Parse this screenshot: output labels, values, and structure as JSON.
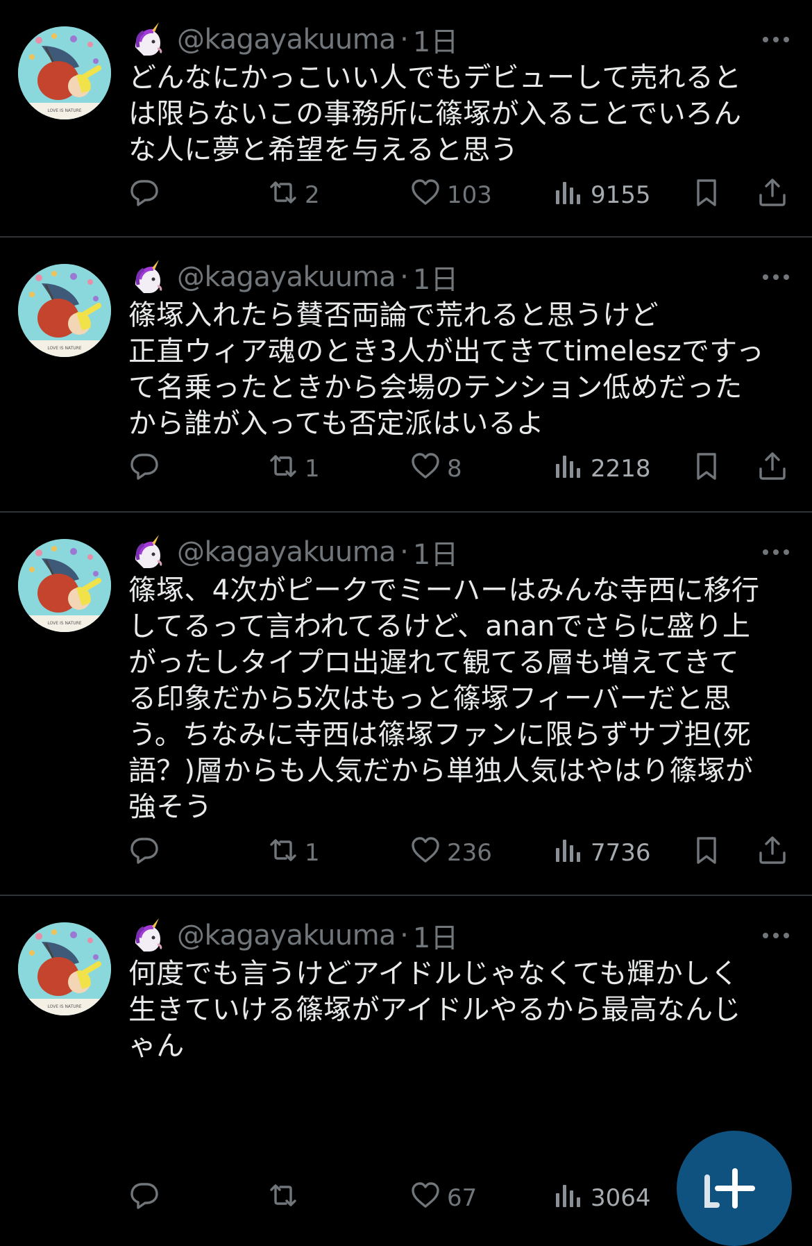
{
  "posts": [
    {
      "handle": "@kagayakuuma",
      "separator": "·",
      "time": "1日",
      "lines": [
        "どんなにかっこいい人でもデビューして売れると",
        "は限らないこの事務所に篠塚が入ることでいろん",
        "な人に夢と希望を与えると思う"
      ],
      "reposts": "2",
      "likes": "103",
      "views": "9155"
    },
    {
      "handle": "@kagayakuuma",
      "separator": "·",
      "time": "1日",
      "lines": [
        "篠塚入れたら賛否両論で荒れると思うけど",
        "正直ウィア魂のとき3人が出てきてtimeleszですっ",
        "て名乗ったときから会場のテンション低めだった",
        "から誰が入っても否定派はいるよ"
      ],
      "reposts": "1",
      "likes": "8",
      "views": "2218"
    },
    {
      "handle": "@kagayakuuma",
      "separator": "·",
      "time": "1日",
      "lines": [
        "篠塚、4次がピークでミーハーはみんな寺西に移行",
        "してるって言われてるけど、ananでさらに盛り上",
        "がったしタイプロ出遅れて観てる層も増えてきて",
        "る印象だから5次はもっと篠塚フィーバーだと思",
        "う。ちなみに寺西は篠塚ファンに限らずサブ担(死",
        "語？)層からも人気だから単独人気はやはり篠塚が",
        "強そう"
      ],
      "reposts": "1",
      "likes": "236",
      "views": "7736"
    },
    {
      "handle": "@kagayakuuma",
      "separator": "·",
      "time": "1日",
      "lines": [
        "何度でも言うけどアイドルじゃなくても輝かしく",
        "生きていける篠塚がアイドルやるから最高なんじ",
        "ゃん"
      ],
      "reposts": "",
      "likes": "67",
      "views": "3064"
    }
  ],
  "icons": {
    "badge": "unicorn-icon",
    "more": "more-icon",
    "reply": "reply-icon",
    "repost": "repost-icon",
    "like": "heart-icon",
    "views": "views-icon",
    "bookmark": "bookmark-icon",
    "share": "share-icon",
    "compose": "compose-plus-icon"
  },
  "colors": {
    "background": "#000000",
    "text": "#e7e9ea",
    "secondary": "#71767b",
    "divider": "#2f3336",
    "fab": "#10527f"
  }
}
